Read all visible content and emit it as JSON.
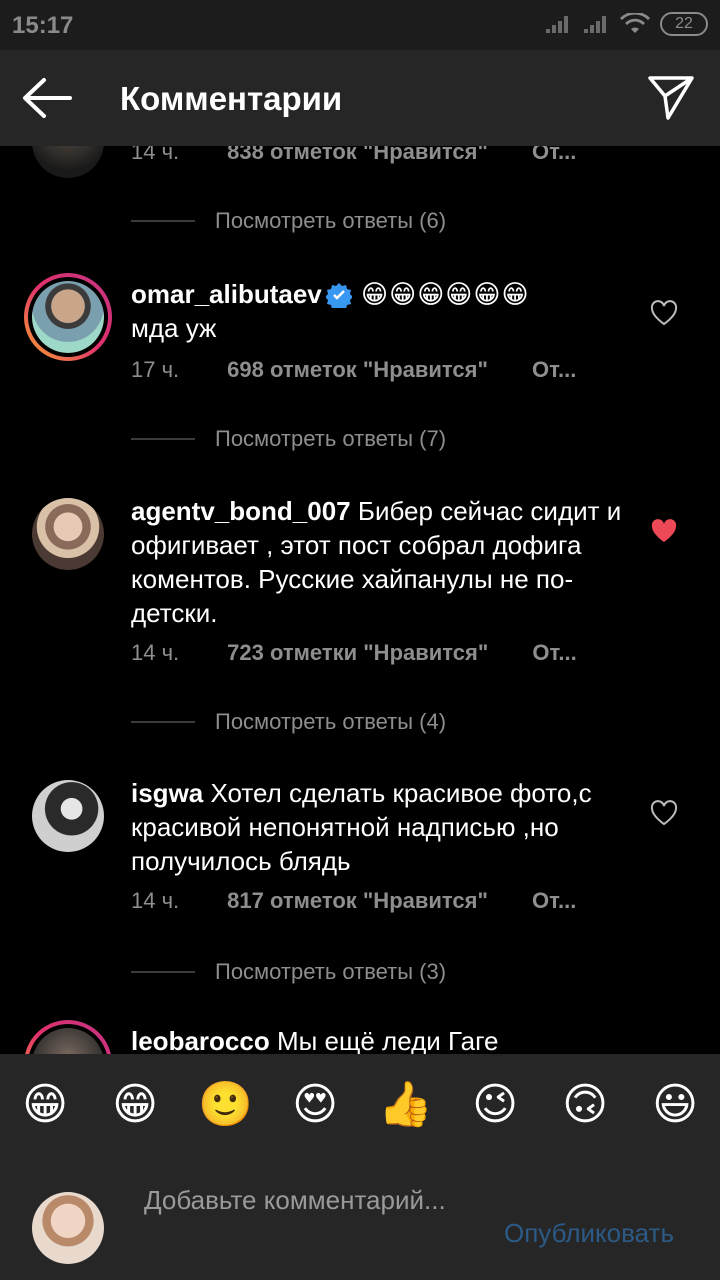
{
  "status": {
    "time": "15:17",
    "battery": "22"
  },
  "header": {
    "title": "Комментарии",
    "back_icon": "arrow-left-icon",
    "send_icon": "paper-plane-icon"
  },
  "comments": [
    {
      "username": "",
      "text": "",
      "time": "14 ч.",
      "likes": "838 отметок \"Нравится\"",
      "reply": "От...",
      "view_replies": "Посмотреть ответы (6)"
    },
    {
      "username": "omar_alibutaev",
      "verified": true,
      "emojis": "😁😁😁😁😁😁",
      "text": "мда уж",
      "time": "17 ч.",
      "likes": "698 отметок \"Нравится\"",
      "reply": "От...",
      "liked": false,
      "view_replies": "Посмотреть ответы (7)"
    },
    {
      "username": "agentv_bond_007",
      "text": "Бибер сейчас сидит и офигивает , этот  пост собрал дофига коментов. Русские хайпанулы не по-детски.",
      "time": "14 ч.",
      "likes": "723 отметки \"Нравится\"",
      "reply": "От...",
      "liked": true,
      "view_replies": "Посмотреть ответы (4)"
    },
    {
      "username": "isgwa",
      "text": "Хотел сделать красивое фото,с красивой непонятной надписью ,но получилось блядь",
      "time": "14 ч.",
      "likes": "817 отметок \"Нравится\"",
      "reply": "От...",
      "liked": false,
      "view_replies": "Посмотреть ответы (3)"
    },
    {
      "username": "leobarocco",
      "text": "Мы ещё леди Гаге"
    }
  ],
  "emoji_bar": [
    "😁",
    "😁",
    "🙂",
    "😍",
    "👍",
    "😉",
    "🙃",
    "😃"
  ],
  "composer": {
    "placeholder": "Добавьте комментарий...",
    "publish": "Опубликовать"
  },
  "colors": {
    "accent_heart": "#ed4956",
    "link_disabled": "#2c5a86",
    "bar_bg": "#262626"
  }
}
